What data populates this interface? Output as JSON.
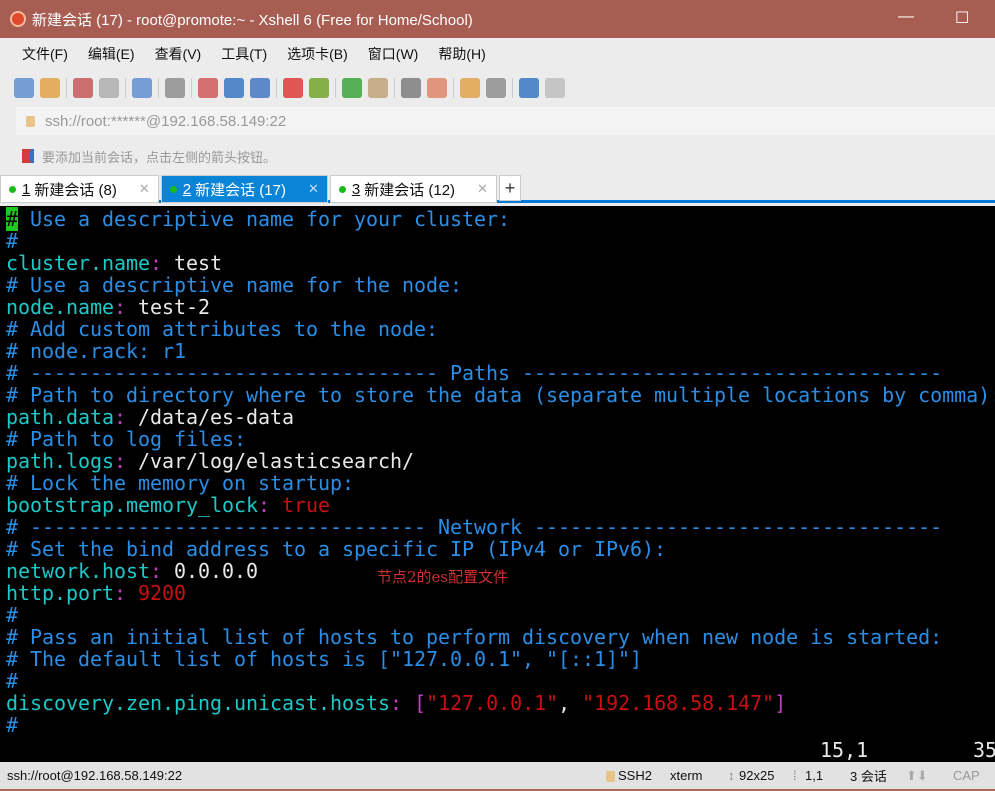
{
  "window": {
    "title": "新建会话 (17) - root@promote:~ - Xshell 6 (Free for Home/School)",
    "minimize": "—",
    "maximize": "☐"
  },
  "menu": [
    "文件(F)",
    "编辑(E)",
    "查看(V)",
    "工具(T)",
    "选项卡(B)",
    "窗口(W)",
    "帮助(H)"
  ],
  "toolbar": [
    "new-session-icon",
    "open-folder-icon",
    "disconnect-icon",
    "reconnect-icon",
    "settings-icon",
    "find-icon",
    "transfer-icon",
    "globe-icon",
    "font-icon",
    "xshell-icon",
    "xftp-icon",
    "fullscreen-icon",
    "lock-icon",
    "keyboard-icon",
    "highlight-icon",
    "new-folder-icon",
    "layout-icon",
    "help-icon",
    "chat-icon"
  ],
  "address": "ssh://root:******@192.168.58.149:22",
  "hint": "要添加当前会话，点击左侧的箭头按钮。",
  "tabs": [
    {
      "num": "1",
      "label": "新建会话 (8)",
      "active": false
    },
    {
      "num": "2",
      "label": "新建会话 (17)",
      "active": true
    },
    {
      "num": "3",
      "label": "新建会话 (12)",
      "active": false
    }
  ],
  "colors": {
    "comment": "#2a8ee6",
    "key": "#1ec8c8",
    "punct": "#c040c0",
    "value": "#e8e8e8",
    "red": "#c81010",
    "active_tab": "#0a84d6"
  },
  "terminal": {
    "lines": [
      [
        [
          "cur",
          "#"
        ],
        [
          "c",
          " Use a descriptive name for your cluster:"
        ]
      ],
      [
        [
          "c",
          "#"
        ]
      ],
      [
        [
          "k",
          "cluster.name"
        ],
        [
          "p",
          ":"
        ],
        [
          "w",
          " test"
        ]
      ],
      [
        [
          "c",
          "# Use a descriptive name for the node:"
        ]
      ],
      [
        [
          "k",
          "node.name"
        ],
        [
          "p",
          ":"
        ],
        [
          "w",
          " test-2"
        ]
      ],
      [
        [
          "c",
          "# Add custom attributes to the node:"
        ]
      ],
      [
        [
          "c",
          "# node.rack: r1"
        ]
      ],
      [
        [
          "c",
          "# ---------------------------------- Paths -----------------------------------"
        ]
      ],
      [
        [
          "c",
          "# Path to directory where to store the data (separate multiple locations by comma):"
        ]
      ],
      [
        [
          "k",
          "path.data"
        ],
        [
          "p",
          ":"
        ],
        [
          "w",
          " /data/es-data"
        ]
      ],
      [
        [
          "c",
          "# Path to log files:"
        ]
      ],
      [
        [
          "k",
          "path.logs"
        ],
        [
          "p",
          ":"
        ],
        [
          "w",
          " /var/log/elasticsearch/"
        ]
      ],
      [
        [
          "c",
          "# Lock the memory on startup:"
        ]
      ],
      [
        [
          "k",
          "bootstrap.memory_lock"
        ],
        [
          "p",
          ":"
        ],
        [
          "r",
          " true"
        ]
      ],
      [
        [
          "c",
          "# --------------------------------- Network ----------------------------------"
        ]
      ],
      [
        [
          "c",
          "# Set the bind address to a specific IP (IPv4 or IPv6):"
        ]
      ],
      [
        [
          "k",
          "network.host"
        ],
        [
          "p",
          ":"
        ],
        [
          "w",
          " 0.0.0.0"
        ]
      ],
      [
        [
          "k",
          "http.port"
        ],
        [
          "p",
          ":"
        ],
        [
          "r",
          " 9200"
        ]
      ],
      [
        [
          "c",
          "#"
        ]
      ],
      [
        [
          "c",
          "# Pass an initial list of hosts to perform discovery when new node is started:"
        ]
      ],
      [
        [
          "c",
          "# The default list of hosts is [\"127.0.0.1\", \"[::1]\"]"
        ]
      ],
      [
        [
          "c",
          "#"
        ]
      ],
      [
        [
          "k",
          "discovery.zen.ping.unicast.hosts"
        ],
        [
          "p",
          ":"
        ],
        [
          "w",
          " "
        ],
        [
          "p",
          "["
        ],
        [
          "r",
          "\"127.0.0.1\""
        ],
        [
          "w",
          ", "
        ],
        [
          "r",
          "\"192.168.58.147\""
        ],
        [
          "p",
          "]"
        ]
      ],
      [
        [
          "c",
          "#"
        ]
      ]
    ],
    "annotation": "节点2的es配置文件",
    "cursor_pos": "15,1",
    "scroll_pos": "35"
  },
  "status": {
    "connection": "ssh://root@192.168.58.149:22",
    "protocol": "SSH2",
    "term": "xterm",
    "size": "92x25",
    "cursor": "1,1",
    "sessions": "3 会话",
    "caps": "CAP"
  }
}
